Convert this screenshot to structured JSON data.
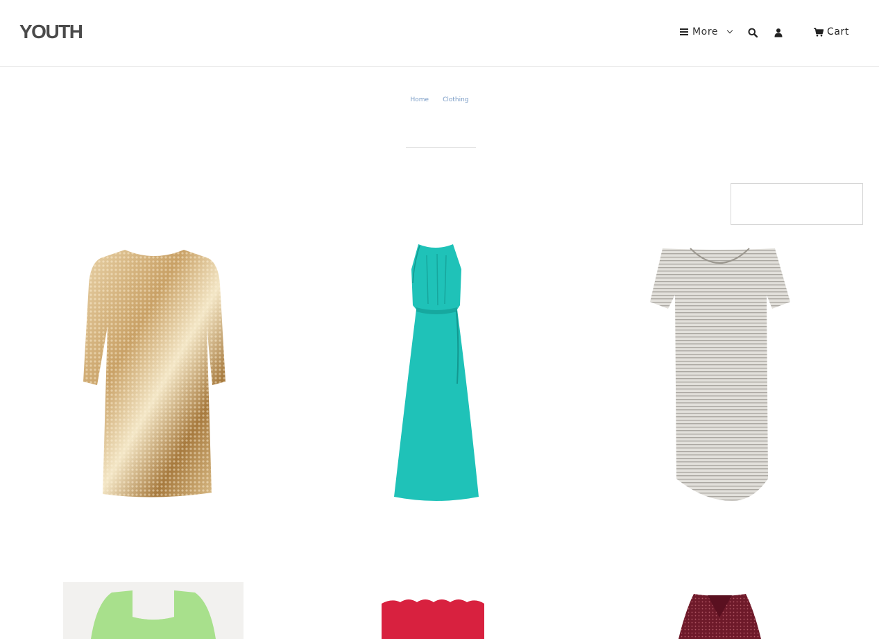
{
  "header": {
    "logo": "YOUTH",
    "nav": {
      "more_label": "More",
      "cart_label": "Cart",
      "icons": [
        "bars-icon",
        "chevron-down-icon",
        "search-icon",
        "user-icon",
        "cart-icon"
      ]
    }
  },
  "breadcrumb": {
    "items": [
      {
        "label": "Home"
      },
      {
        "label": "Clothing"
      }
    ]
  },
  "colors": {
    "link": "#7a9cc6",
    "text": "#333333",
    "border": "#e6e6e6"
  },
  "products": [
    {
      "name": "gold-sequin-dress"
    },
    {
      "name": "turquoise-halter-maxi-dress"
    },
    {
      "name": "grey-striped-tshirt-dress"
    },
    {
      "name": "green-square-neck-dress"
    },
    {
      "name": "red-off-shoulder-dress"
    },
    {
      "name": "burgundy-wrap-dress"
    }
  ]
}
